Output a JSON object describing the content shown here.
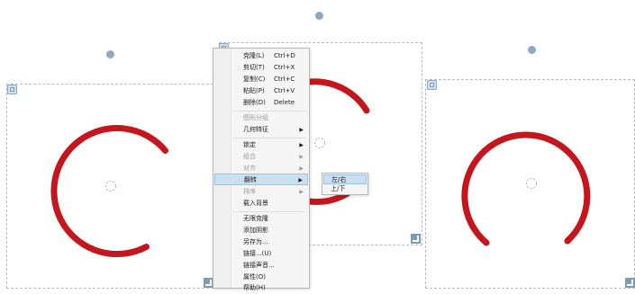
{
  "context_menu": {
    "items": [
      {
        "label": "克隆(L)",
        "shortcut": "Ctrl+D"
      },
      {
        "label": "剪切(T)",
        "shortcut": "Ctrl+X"
      },
      {
        "label": "复制(C)",
        "shortcut": "Ctrl+C"
      },
      {
        "label": "粘贴(P)",
        "shortcut": "Ctrl+V"
      },
      {
        "label": "删除(D)",
        "shortcut": "Delete"
      },
      {
        "label": "图形分组"
      },
      {
        "label": "几何特征"
      },
      {
        "label": "锁定"
      },
      {
        "label": "组合"
      },
      {
        "label": "对齐"
      },
      {
        "label": "翻转"
      },
      {
        "label": "排序"
      },
      {
        "label": "载入背景"
      },
      {
        "label": "无限克隆"
      },
      {
        "label": "添加阴影"
      },
      {
        "label": "另存为..."
      },
      {
        "label": "链接...(U)"
      },
      {
        "label": "链接声音..."
      },
      {
        "label": "属性(O)"
      },
      {
        "label": "帮助(H)"
      }
    ]
  },
  "flip_submenu": {
    "items": [
      {
        "label": "左/右"
      },
      {
        "label": "上/下"
      }
    ]
  },
  "colors": {
    "arc": "#c4161c",
    "selection_dash": "#b9b9b9",
    "handle": "#8ea9bf",
    "menu_highlight": "#c9dff2"
  }
}
